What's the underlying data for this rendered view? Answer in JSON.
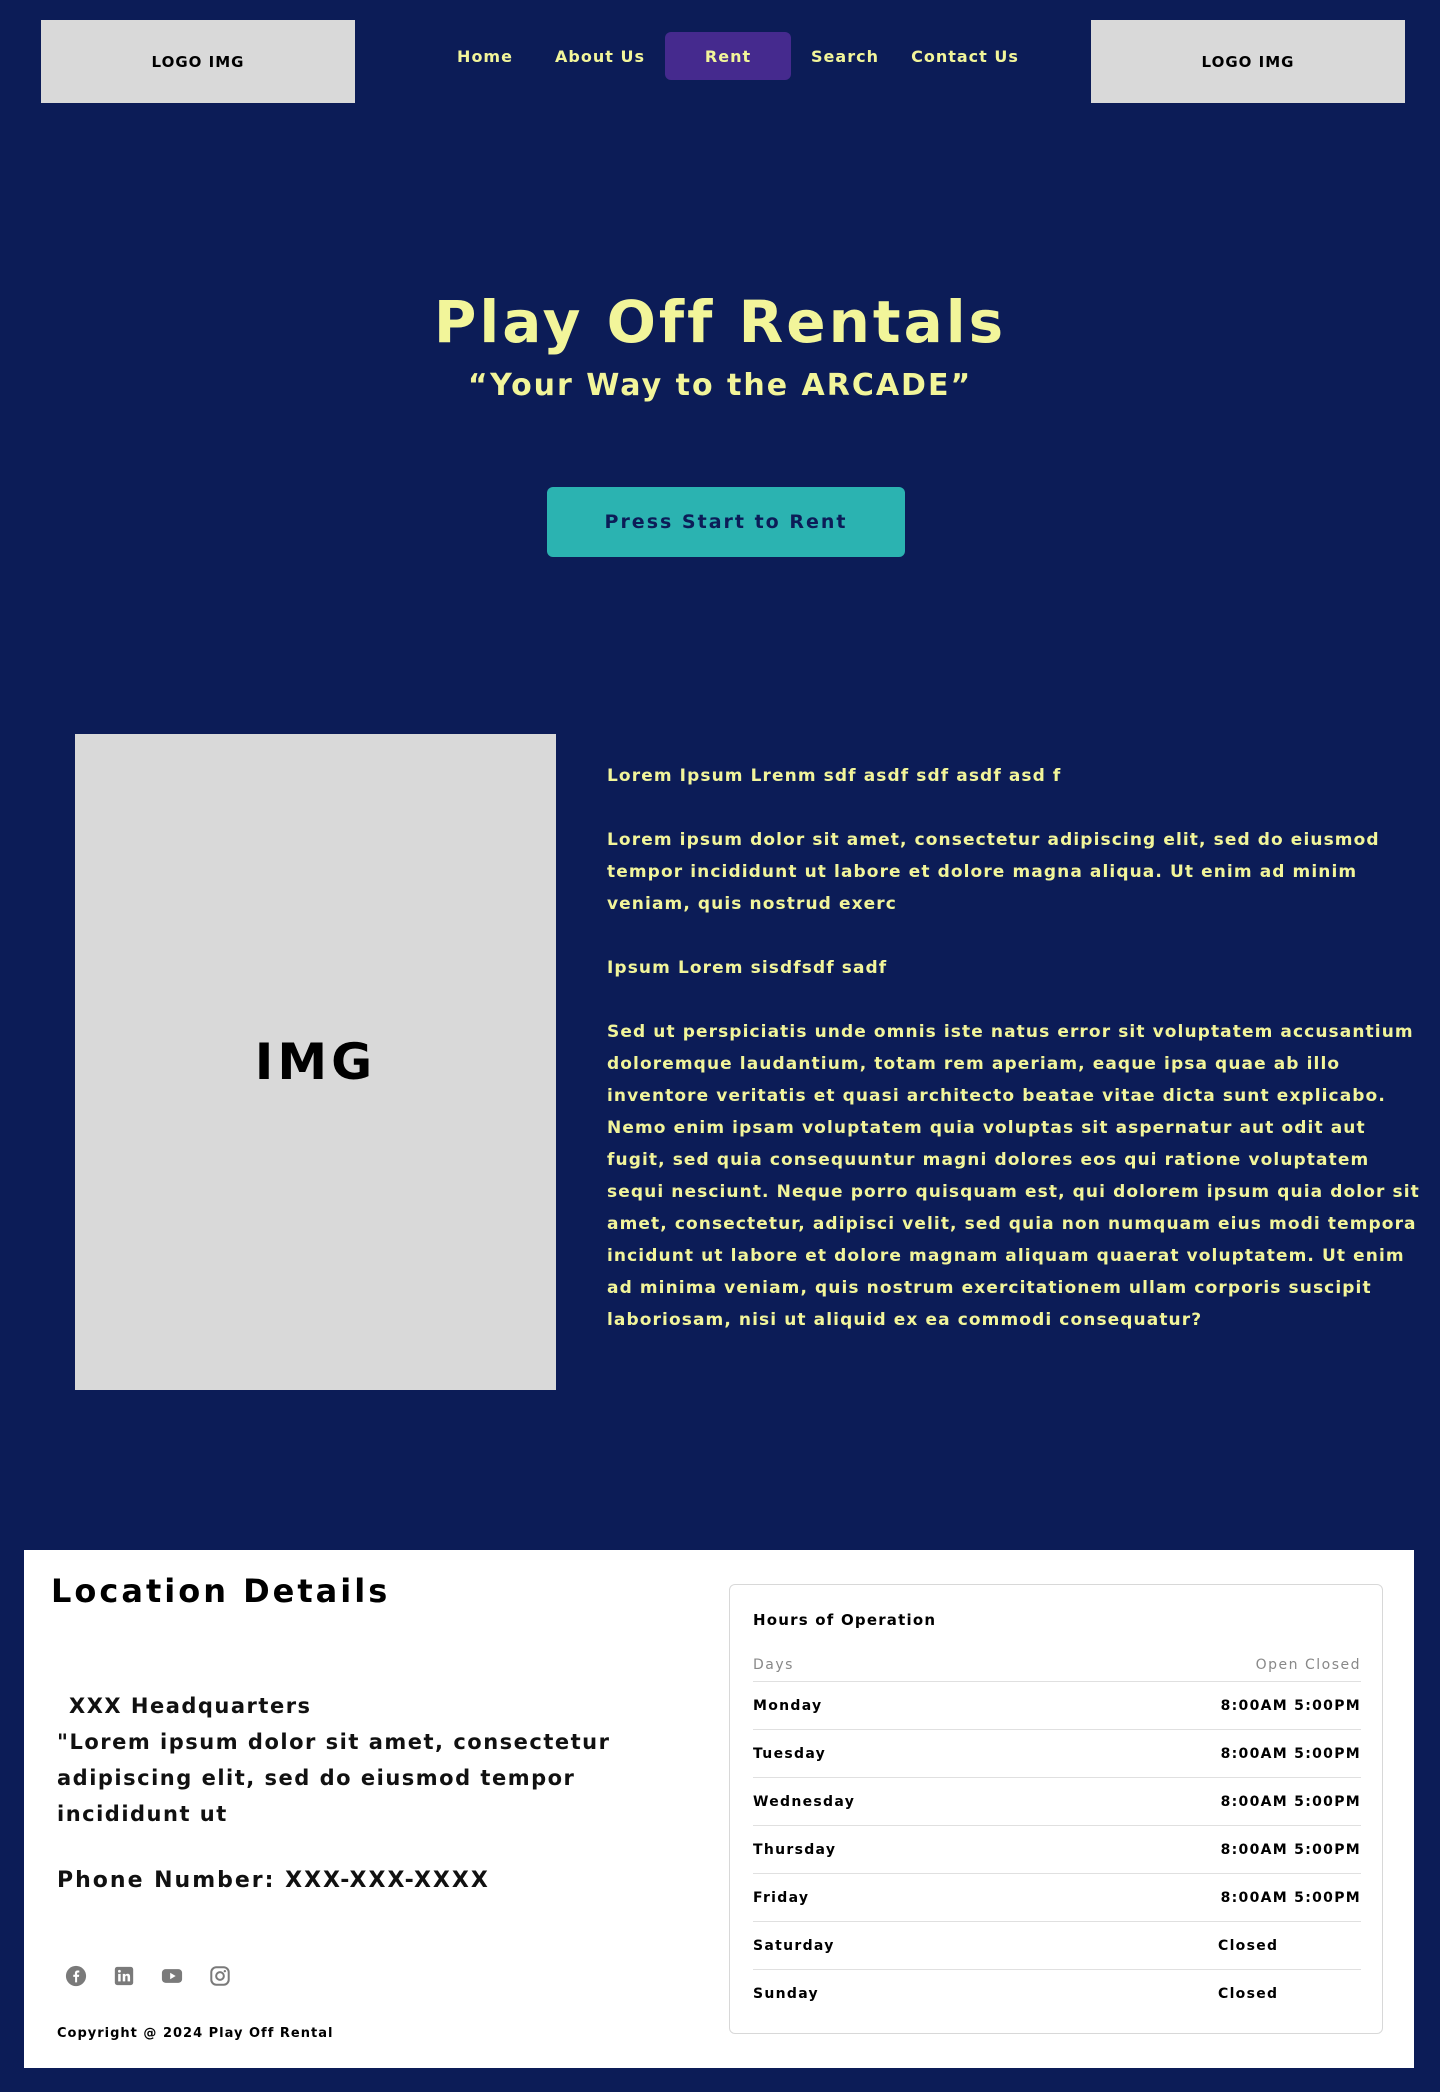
{
  "header": {
    "logo_left": "LOGO IMG",
    "logo_right": "LOGO IMG",
    "nav": {
      "home": "Home",
      "about": "About Us",
      "rent": "Rent",
      "search": "Search",
      "contact": "Contact Us"
    },
    "active_nav": "Rent"
  },
  "hero": {
    "title": "Play Off Rentals",
    "subtitle": "“Your Way to the ARCADE”",
    "cta_label": "Press Start to Rent"
  },
  "intro": {
    "image_label": "IMG",
    "heading1": "Lorem Ipsum Lrenm sdf asdf sdf asdf asd f",
    "para1": "Lorem ipsum dolor sit amet, consectetur adipiscing elit, sed do eiusmod tempor incididunt ut labore et dolore magna aliqua. Ut enim ad minim veniam, quis nostrud exerc",
    "heading2": "Ipsum Lorem sisdfsdf sadf",
    "para2": "Sed ut perspiciatis unde omnis iste natus error sit voluptatem accusantium doloremque laudantium, totam rem aperiam, eaque ipsa quae ab illo inventore veritatis et quasi architecto beatae vitae dicta sunt explicabo. Nemo enim ipsam voluptatem quia voluptas sit aspernatur aut odit aut fugit, sed quia consequuntur magni dolores eos qui ratione voluptatem sequi nesciunt. Neque porro quisquam est, qui dolorem ipsum quia dolor sit amet, consectetur, adipisci velit, sed quia non numquam eius modi tempora incidunt ut labore et dolore magnam aliquam quaerat voluptatem. Ut enim ad minima veniam, quis nostrum exercitationem ullam corporis suscipit laboriosam, nisi ut aliquid ex ea commodi consequatur?"
  },
  "location": {
    "title": "Location Details",
    "hq_name": "XXX Headquarters",
    "hq_desc": "\"Lorem ipsum dolor sit amet, consectetur adipiscing elit, sed do eiusmod tempor incididunt ut",
    "phone": "Phone Number: XXX-XXX-XXXX",
    "social_icons": [
      "facebook-icon",
      "linkedin-icon",
      "youtube-icon",
      "instagram-icon"
    ],
    "copyright": "Copyright @ 2024 Play Off Rental"
  },
  "hours": {
    "title": "Hours of Operation",
    "col_days": "Days",
    "col_open_closed": "Open  Closed",
    "rows": [
      {
        "day": "Monday",
        "time": "8:00AM 5:00PM"
      },
      {
        "day": "Tuesday",
        "time": "8:00AM 5:00PM"
      },
      {
        "day": "Wednesday",
        "time": "8:00AM 5:00PM"
      },
      {
        "day": "Thursday",
        "time": "8:00AM 5:00PM"
      },
      {
        "day": "Friday",
        "time": "8:00AM 5:00PM"
      },
      {
        "day": "Saturday",
        "closed": "Closed"
      },
      {
        "day": "Sunday",
        "closed": "Closed"
      }
    ]
  },
  "colors": {
    "background": "#0c1c57",
    "accent_yellow": "#f2f59a",
    "nav_active": "#452a8e",
    "cta": "#2bb3b1",
    "placeholder": "#d9d9d9"
  }
}
